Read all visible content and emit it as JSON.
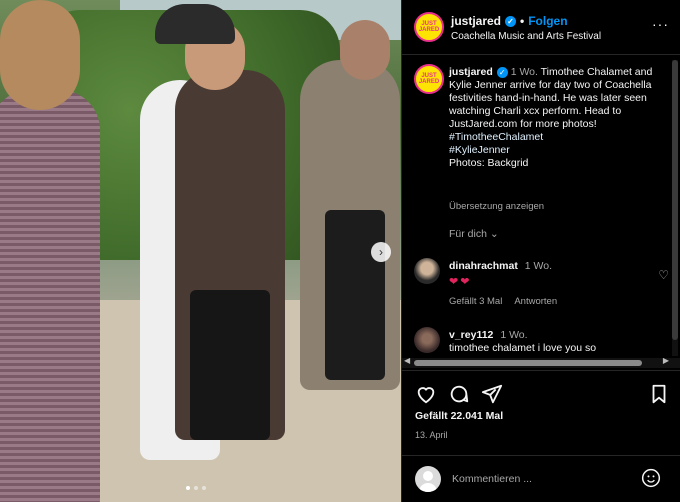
{
  "post": {
    "username": "justjared",
    "follow_label": "Folgen",
    "location": "Coachella Music and Arts Festival",
    "avatar_text": "JUST JARED",
    "caption_time": "1 Wo.",
    "caption_text": "Timothee Chalamet and Kylie Jenner arrive for day two of Coachella festivities hand-in-hand. He was later seen watching Charli xcx perform. Head to JustJared.com for more photos!",
    "hashtags": [
      "#TimotheeChalamet",
      "#KylieJenner"
    ],
    "photo_credit": "Photos: Backgrid",
    "translate_label": "Übersetzung anzeigen",
    "see_more_label": "Für dich"
  },
  "comments": [
    {
      "username": "dinahrachmat",
      "time": "1 Wo.",
      "text": "❤❤",
      "likes": "Gefällt 3 Mal",
      "reply_label": "Antworten"
    },
    {
      "username": "v_rey112",
      "time": "1 Wo.",
      "text": "timothee chalamet i love you so"
    }
  ],
  "likes_text": "Gefällt 22.041 Mal",
  "date_text": "13. April",
  "comment_placeholder": "Kommentieren ...",
  "icons": {
    "like": "heart-icon",
    "comment": "comment-icon",
    "share": "share-icon",
    "save": "bookmark-icon",
    "more": "more-icon",
    "emoji": "emoji-icon"
  },
  "colors": {
    "accent": "#0095f6",
    "background": "#000000",
    "muted": "#a8a8a8",
    "brand_yellow": "#fde403",
    "brand_pink": "#e8308b"
  }
}
